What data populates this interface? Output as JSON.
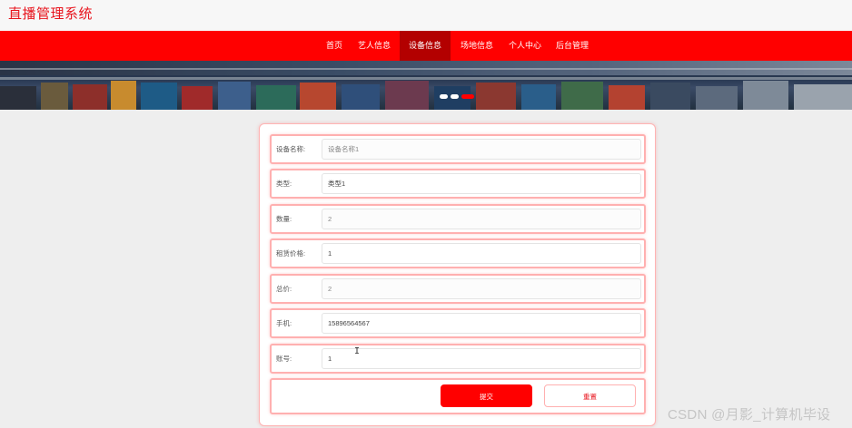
{
  "header": {
    "site_title": "直播管理系统"
  },
  "nav": {
    "items": [
      {
        "label": "首页"
      },
      {
        "label": "艺人信息"
      },
      {
        "label": "设备信息",
        "active": true
      },
      {
        "label": "场地信息"
      },
      {
        "label": "个人中心"
      },
      {
        "label": "后台管理"
      }
    ]
  },
  "banner": {
    "slides": 3,
    "active_slide": 3
  },
  "form": {
    "fields": [
      {
        "label": "设备名称:",
        "value": "设备名称1",
        "editable": false
      },
      {
        "label": "类型:",
        "value": "类型1",
        "editable": true
      },
      {
        "label": "数量:",
        "value": "2",
        "editable": false
      },
      {
        "label": "租赁价格:",
        "value": "1",
        "editable": true
      },
      {
        "label": "总价:",
        "value": "2",
        "editable": false
      },
      {
        "label": "手机:",
        "value": "15896564567",
        "editable": true
      },
      {
        "label": "账号:",
        "value": "1",
        "editable": true
      }
    ],
    "submit_label": "提交",
    "reset_label": "重置"
  },
  "watermark": "CSDN @月影_计算机毕设",
  "colors": {
    "brand": "#ff0000",
    "active_nav": "#b30000",
    "title": "#e8141d"
  }
}
